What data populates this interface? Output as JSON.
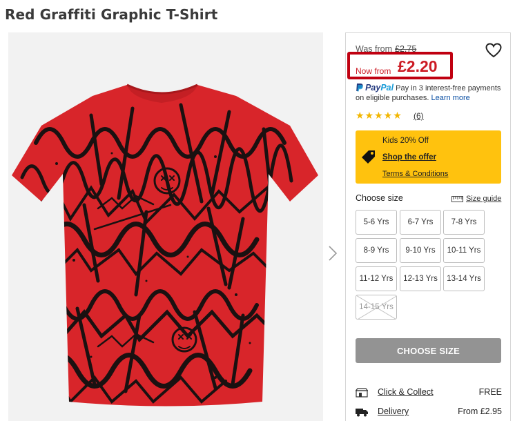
{
  "product": {
    "title": "Red Graffiti Graphic T-Shirt"
  },
  "price": {
    "was_label": "Was from",
    "was_value": "£2.75",
    "now_label": "Now from",
    "now_value": "£2.20"
  },
  "paypal": {
    "logo_p1": "Pay",
    "logo_p2": "Pal",
    "text": "Pay in 3 interest-free payments on eligible purchases.",
    "learn_more": "Learn more"
  },
  "rating": {
    "stars": 5,
    "stars_text": "★★★★★",
    "count": "(6)"
  },
  "offer": {
    "headline": "Kids 20% Off",
    "shop_link": "Shop the offer",
    "terms_link": "Terms & Conditions",
    "bg_color": "#ffc20e"
  },
  "size": {
    "label": "Choose size",
    "guide_label": "Size guide",
    "options": [
      {
        "label": "5-6 Yrs",
        "available": true
      },
      {
        "label": "6-7 Yrs",
        "available": true
      },
      {
        "label": "7-8 Yrs",
        "available": true
      },
      {
        "label": "8-9 Yrs",
        "available": true
      },
      {
        "label": "9-10 Yrs",
        "available": true
      },
      {
        "label": "10-11 Yrs",
        "available": true
      },
      {
        "label": "11-12 Yrs",
        "available": true
      },
      {
        "label": "12-13 Yrs",
        "available": true
      },
      {
        "label": "13-14 Yrs",
        "available": true
      },
      {
        "label": "14-15 Yrs",
        "available": false
      }
    ]
  },
  "cta": {
    "label": "CHOOSE SIZE"
  },
  "delivery": {
    "click_collect_label": "Click & Collect",
    "click_collect_value": "FREE",
    "delivery_label": "Delivery",
    "delivery_value": "From £2.95"
  },
  "icons": {
    "wishlist": "heart-icon",
    "next": "chevron-right-icon",
    "offer": "price-tag-icon",
    "size_guide": "ruler-icon",
    "click_collect": "store-icon",
    "delivery": "truck-icon"
  },
  "colors": {
    "sale_red": "#cc1b24",
    "highlight_border": "#c00010",
    "shirt_red": "#d8252a",
    "cta_grey": "#939393"
  }
}
